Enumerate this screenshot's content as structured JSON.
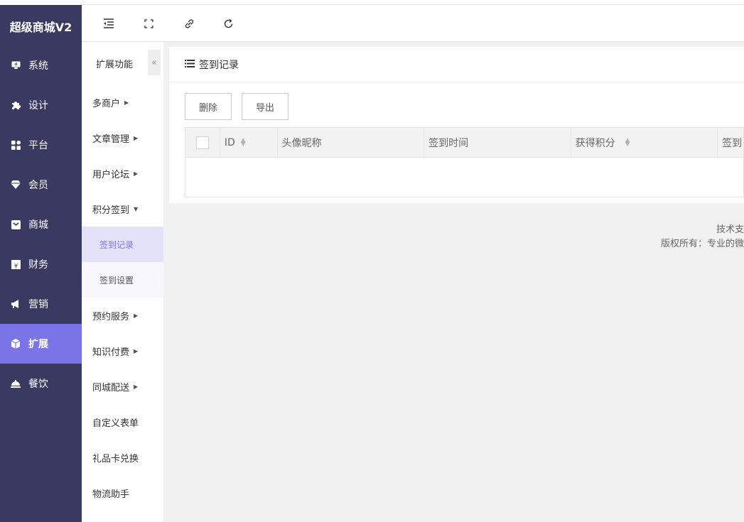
{
  "brand": "超级商城V2",
  "primary_nav": [
    {
      "label": "系统",
      "icon": "monitor-icon"
    },
    {
      "label": "设计",
      "icon": "puzzle-icon"
    },
    {
      "label": "平台",
      "icon": "grid-icon"
    },
    {
      "label": "会员",
      "icon": "diamond-icon"
    },
    {
      "label": "商城",
      "icon": "store-icon"
    },
    {
      "label": "财务",
      "icon": "yen-icon"
    },
    {
      "label": "营销",
      "icon": "megaphone-icon"
    },
    {
      "label": "扩展",
      "icon": "cube-icon",
      "active": true
    },
    {
      "label": "餐饮",
      "icon": "tray-icon"
    }
  ],
  "secondary_nav": {
    "title": "扩展功能",
    "items": [
      {
        "label": "多商户",
        "expandable": true
      },
      {
        "label": "文章管理",
        "expandable": true
      },
      {
        "label": "用户论坛",
        "expandable": true
      },
      {
        "label": "积分签到",
        "expanded": true
      },
      {
        "label": "签到记录",
        "sub": true,
        "active": true
      },
      {
        "label": "签到设置",
        "sub": true
      },
      {
        "label": "预约服务",
        "expandable": true
      },
      {
        "label": "知识付费",
        "expandable": true
      },
      {
        "label": "同城配送",
        "expandable": true
      },
      {
        "label": "自定义表单"
      },
      {
        "label": "礼品卡兑换"
      },
      {
        "label": "物流助手"
      }
    ]
  },
  "page": {
    "title": "签到记录",
    "buttons": {
      "delete": "删除",
      "export": "导出"
    },
    "columns": [
      "ID",
      "头像昵称",
      "签到时间",
      "获得积分",
      "签到"
    ]
  },
  "footer": {
    "line1": "技术支",
    "line2": "版权所有：专业的微"
  },
  "colors": {
    "sidebar": "#393961",
    "accent": "#7b74e6"
  }
}
